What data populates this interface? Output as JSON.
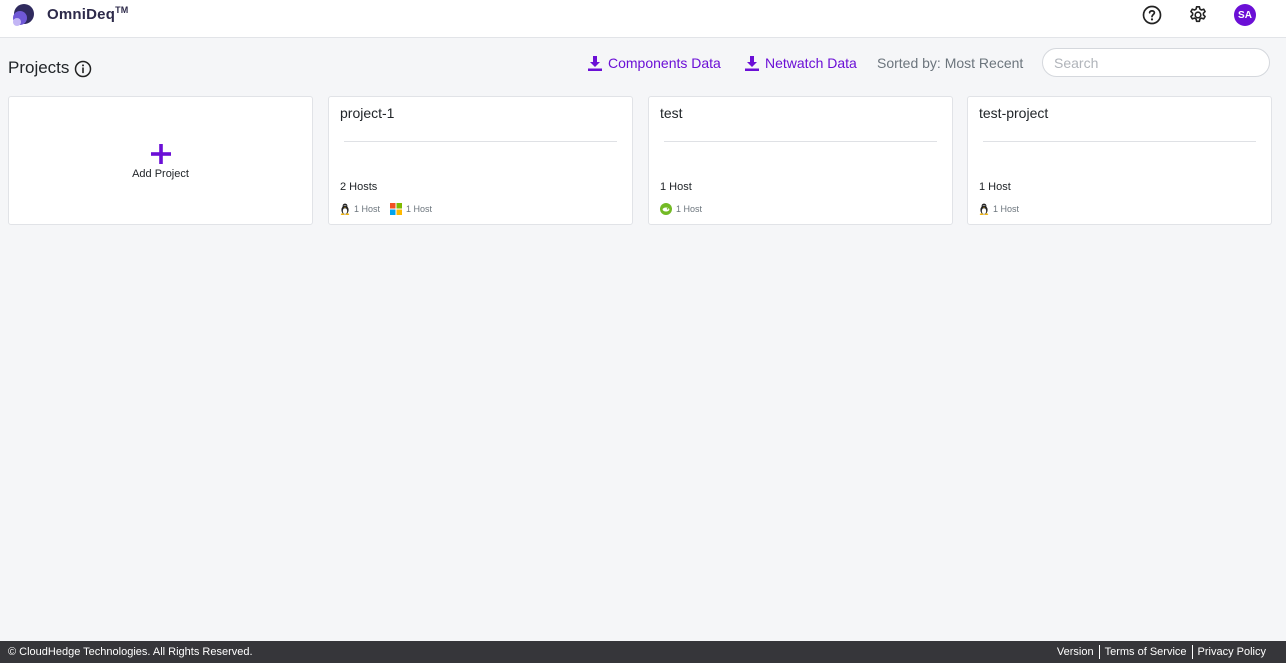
{
  "app": {
    "brand": "OmniDeq",
    "trademark": "TM",
    "user_initials": "SA"
  },
  "header": {
    "title": "Projects",
    "components_link": "Components Data",
    "netwatch_link": "Netwatch Data",
    "sorted_label": "Sorted by: Most Recent",
    "search_placeholder": "Search"
  },
  "add_card": {
    "label": "Add Project"
  },
  "projects": [
    {
      "name": "project-1",
      "hosts": "2 Hosts",
      "os": [
        {
          "icon": "linux-tux-icon",
          "count": "1 Host"
        },
        {
          "icon": "windows-logo-icon",
          "count": "1 Host"
        }
      ]
    },
    {
      "name": "test",
      "hosts": "1 Host",
      "os": [
        {
          "icon": "suse-logo-icon",
          "count": "1 Host"
        }
      ]
    },
    {
      "name": "test-project",
      "hosts": "1 Host",
      "os": [
        {
          "icon": "linux-tux-icon",
          "count": "1 Host"
        }
      ]
    }
  ],
  "footer": {
    "copyright": "© CloudHedge Technologies. All Rights Reserved.",
    "links": [
      "Version",
      "Terms of Service",
      "Privacy Policy"
    ]
  },
  "colors": {
    "accent": "#6b0fd6",
    "background": "#f5f6f8",
    "footer": "#36363a"
  }
}
